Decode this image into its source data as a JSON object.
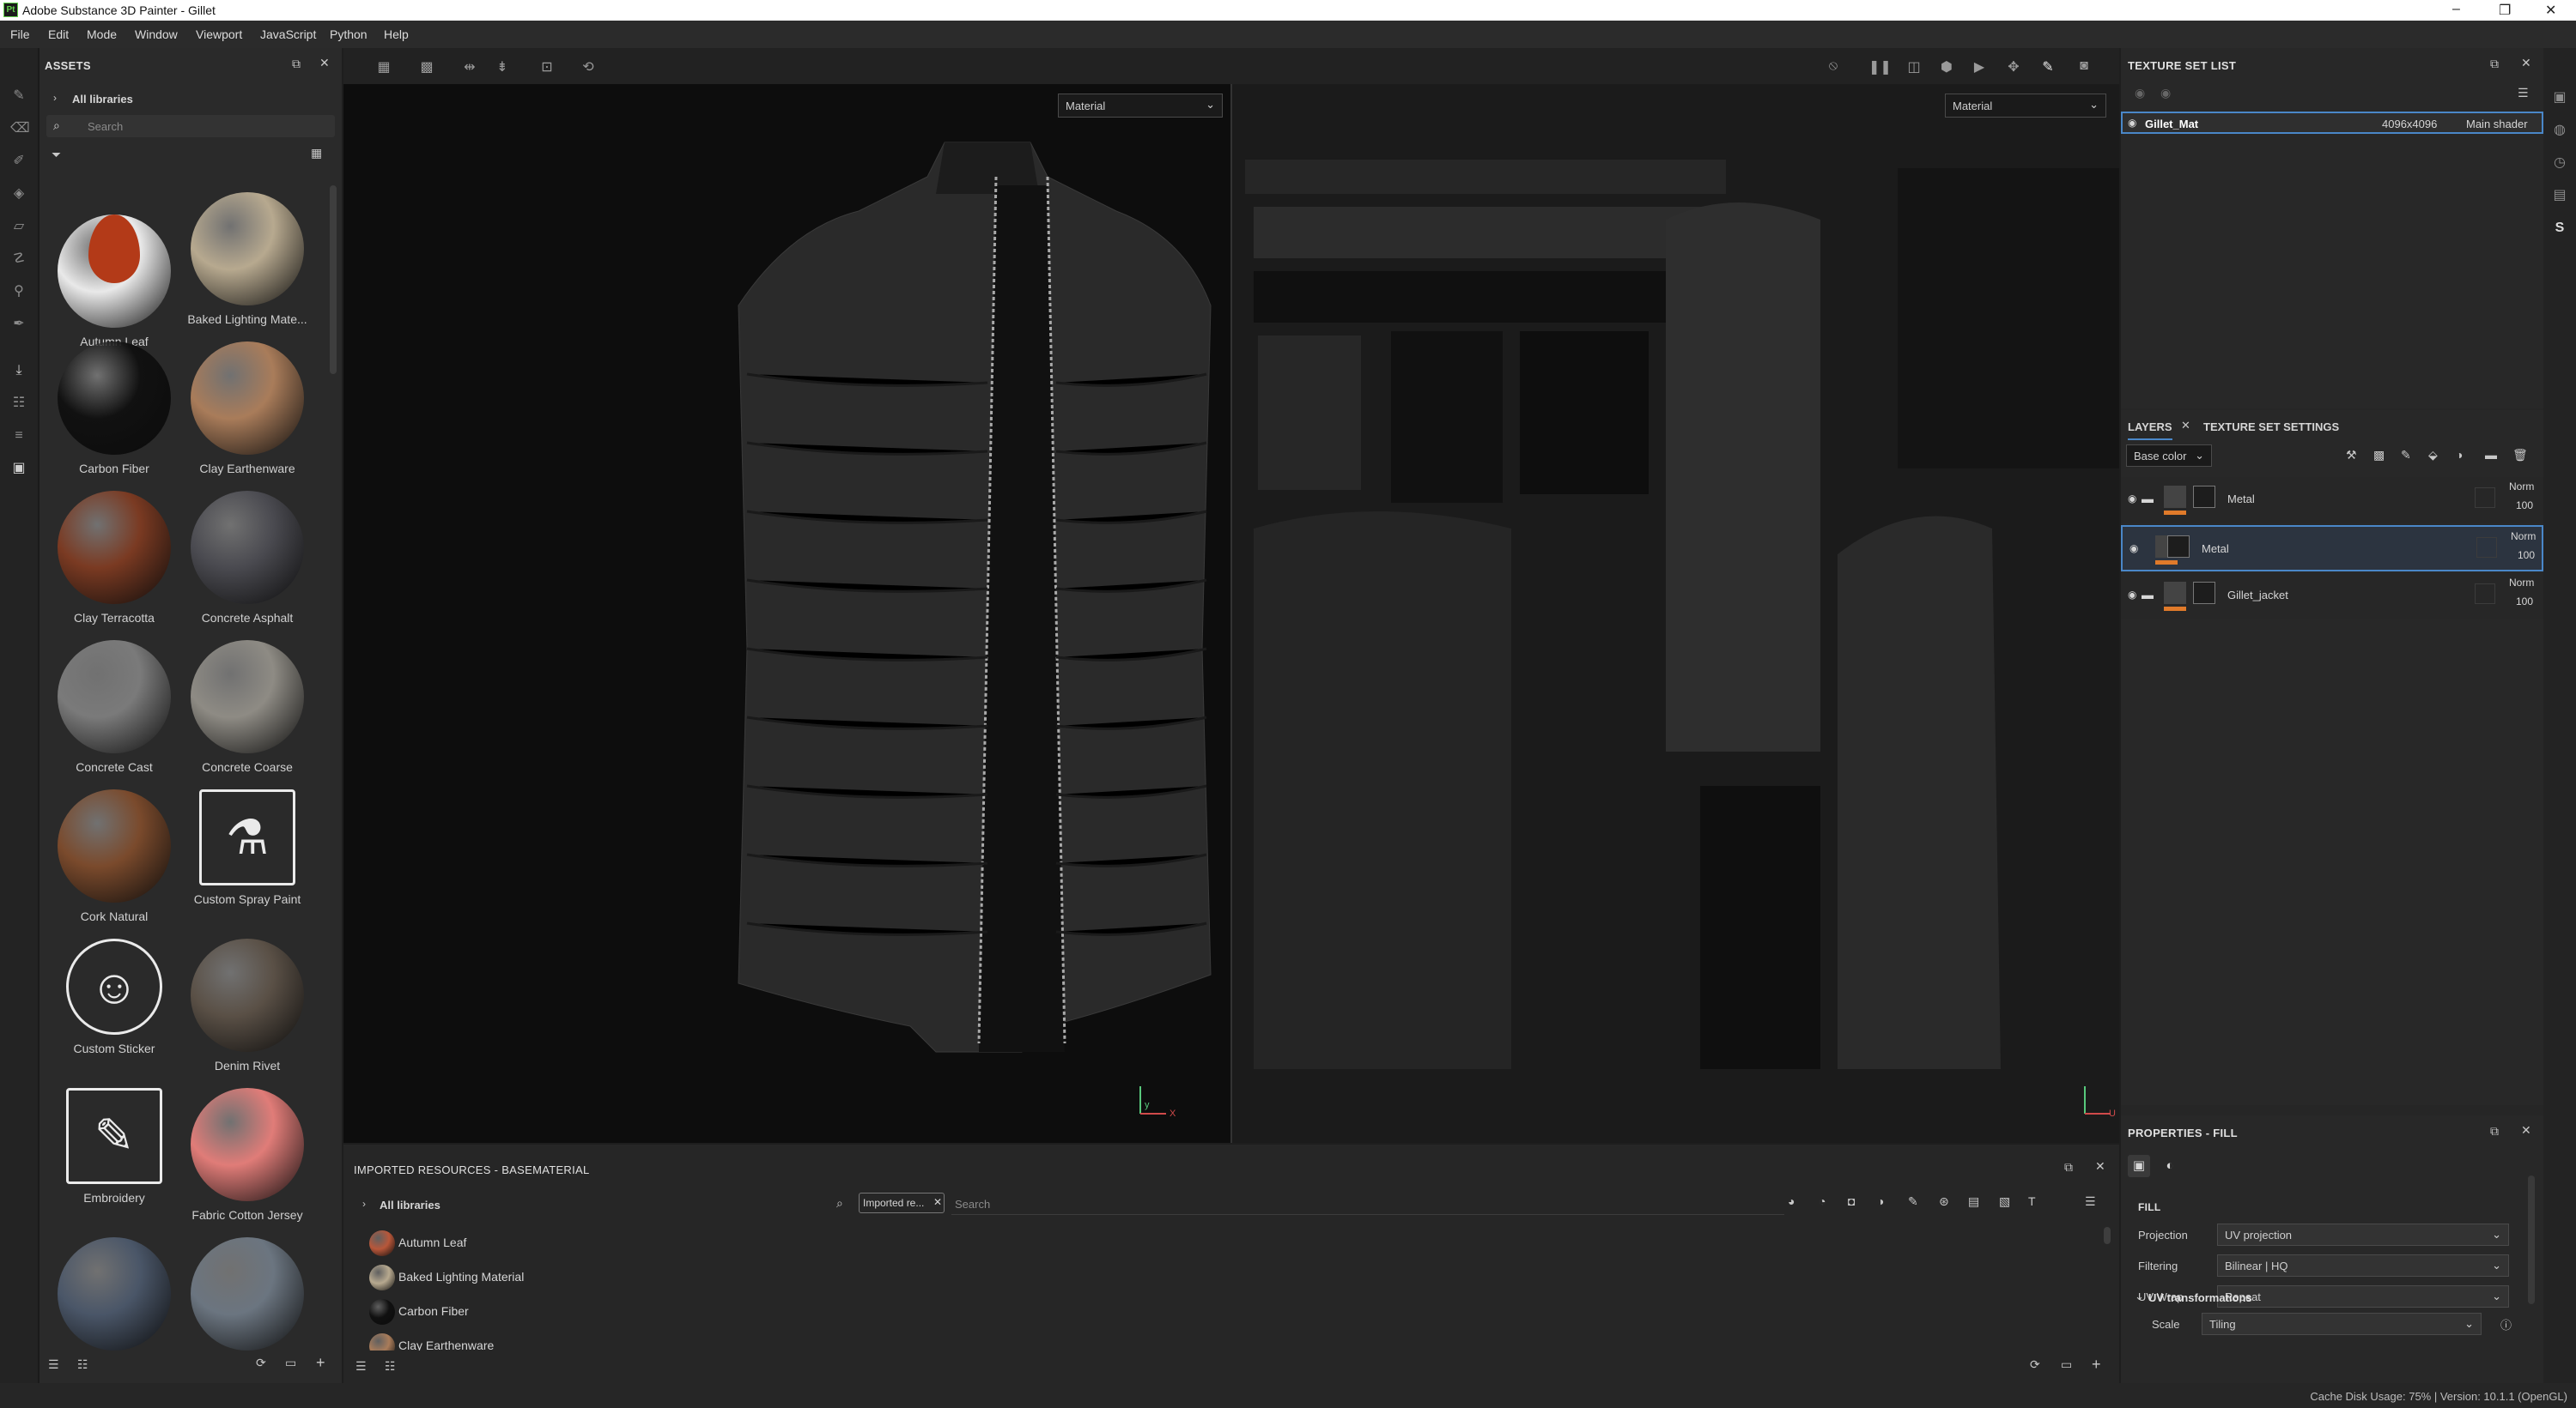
{
  "window": {
    "title": "Adobe Substance 3D Painter - Gillet",
    "logo_text": "Pt"
  },
  "window_controls": {
    "minimize": "–",
    "maximize": "❐",
    "close": "✕"
  },
  "menu": {
    "items": [
      "File",
      "Edit",
      "Mode",
      "Window",
      "Viewport",
      "JavaScript",
      "Python",
      "Help"
    ]
  },
  "assets": {
    "title": "ASSETS",
    "libraries": "All libraries",
    "search_placeholder": "Search",
    "materials": [
      {
        "name": "Autumn Leaf",
        "color": "#e9e9e9",
        "accent": "#b33a18"
      },
      {
        "name": "Baked Lighting Mate...",
        "color": "#b7a98f",
        "accent": ""
      },
      {
        "name": "Carbon Fiber",
        "color": "#111111",
        "accent": ""
      },
      {
        "name": "Clay Earthenware",
        "color": "#a97c5a",
        "accent": ""
      },
      {
        "name": "Clay Terracotta",
        "color": "#7a3a22",
        "accent": ""
      },
      {
        "name": "Concrete Asphalt",
        "color": "#4a4a50",
        "accent": ""
      },
      {
        "name": "Concrete Cast",
        "color": "#7a7a7a",
        "accent": ""
      },
      {
        "name": "Concrete Coarse",
        "color": "#8e8b84",
        "accent": ""
      },
      {
        "name": "Cork Natural",
        "color": "#7a4a2c",
        "accent": ""
      },
      {
        "name": "Custom Spray Paint",
        "color": "icon",
        "accent": "spray"
      },
      {
        "name": "Custom Sticker",
        "color": "icon",
        "accent": "sticker"
      },
      {
        "name": "Denim Rivet",
        "color": "#5a5046",
        "accent": ""
      },
      {
        "name": "Embroidery",
        "color": "icon",
        "accent": "embroidery"
      },
      {
        "name": "Fabric Cotton Jersey",
        "color": "#e07c78",
        "accent": ""
      },
      {
        "name": "",
        "color": "#4a5668",
        "accent": ""
      },
      {
        "name": "",
        "color": "#6b7580",
        "accent": ""
      }
    ]
  },
  "viewport": {
    "left_dropdown": "Material",
    "right_dropdown": "Material",
    "axis_3d": "X",
    "axis_uv": "U"
  },
  "texture_set_list": {
    "title": "TEXTURE SET LIST",
    "item": {
      "name": "Gillet_Mat",
      "resolution": "4096x4096",
      "shader": "Main shader"
    }
  },
  "layers": {
    "tab_layers": "LAYERS",
    "tab_tss": "TEXTURE SET SETTINGS",
    "channel": "Base color",
    "items": [
      {
        "name": "Metal",
        "blend": "Norm",
        "opacity": "100",
        "type": "folder"
      },
      {
        "name": "Metal",
        "blend": "Norm",
        "opacity": "100",
        "type": "fill"
      },
      {
        "name": "Gillet_jacket",
        "blend": "Norm",
        "opacity": "100",
        "type": "folder"
      }
    ]
  },
  "properties": {
    "title": "PROPERTIES - FILL",
    "section": "FILL",
    "fields": [
      {
        "label": "Projection",
        "value": "UV projection"
      },
      {
        "label": "Filtering",
        "value": "Bilinear | HQ"
      },
      {
        "label": "UV Wrap",
        "value": "Repeat"
      }
    ],
    "uv_transform": "UV transformations",
    "scale_label": "Scale",
    "scale_value": "Tiling"
  },
  "imported": {
    "title": "IMPORTED RESOURCES - BASEMATERIAL",
    "libraries": "All libraries",
    "filter_chip": "Imported re...",
    "search_placeholder": "Search",
    "items": [
      {
        "name": "Autumn Leaf",
        "color": "#b8573a"
      },
      {
        "name": "Baked Lighting Material",
        "color": "#b7a98f"
      },
      {
        "name": "Carbon Fiber",
        "color": "#111111"
      },
      {
        "name": "Clay Earthenware",
        "color": "#a97c5a"
      }
    ]
  },
  "status": {
    "text": "Cache Disk Usage:    75% | Version: 10.1.1 (OpenGL)"
  }
}
